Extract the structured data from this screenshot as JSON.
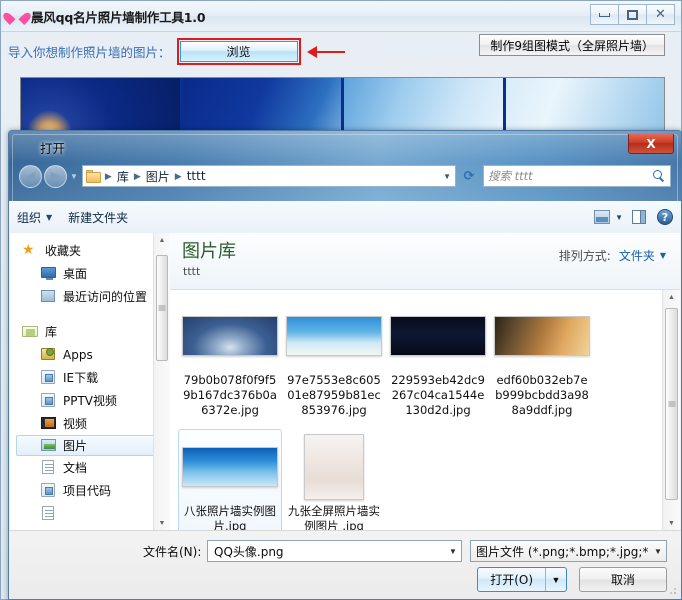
{
  "app": {
    "title": "晨风qq名片照片墙制作工具1.0",
    "icon": "heart-icon",
    "window_buttons": {
      "minimize": "minimize-icon",
      "maximize": "maximize-icon",
      "close": "close-icon"
    },
    "import_label": "导入你想制作照片墙的图片：",
    "browse_button": "浏览",
    "make9_button": "制作9组图模式（全屏照片墙）",
    "highlight_color": "#e01b1b",
    "label_color": "#3a6fb5"
  },
  "dialog": {
    "title": "打开",
    "icon": "heart-icon",
    "close_label": "X",
    "nav": {
      "back": "◀",
      "forward": "▶",
      "history_caret": "▼",
      "breadcrumb": [
        "库",
        "图片",
        "tttt"
      ],
      "breadcrumb_caret": "▼",
      "refresh": "refresh-icon",
      "search_placeholder": "搜索 tttt"
    },
    "commandbar": {
      "organize": "组织",
      "new_folder": "新建文件夹",
      "view_icon": "view-mode-icon",
      "view_caret": "▼",
      "preview_pane_icon": "preview-pane-icon",
      "help_icon": "?"
    },
    "sidebar": {
      "groups": [
        {
          "label": "收藏夹",
          "icon": "star-icon",
          "items": [
            {
              "label": "桌面",
              "icon": "desktop-icon"
            },
            {
              "label": "最近访问的位置",
              "icon": "recent-places-icon"
            }
          ]
        },
        {
          "label": "库",
          "icon": "library-icon",
          "items": [
            {
              "label": "Apps",
              "icon": "apps-icon"
            },
            {
              "label": "IE下载",
              "icon": "folder-blue-icon"
            },
            {
              "label": "PPTV视频",
              "icon": "folder-blue-icon"
            },
            {
              "label": "视频",
              "icon": "film-icon"
            },
            {
              "label": "图片",
              "icon": "pictures-icon",
              "selected": true
            },
            {
              "label": "文档",
              "icon": "document-icon"
            },
            {
              "label": "项目代码",
              "icon": "folder-blue-icon"
            }
          ]
        }
      ]
    },
    "library": {
      "title": "图片库",
      "subtitle": "tttt",
      "arrange_label": "排列方式:",
      "arrange_value": "文件夹",
      "arrange_caret": "▼"
    },
    "files": [
      {
        "name": "79b0b078f0f9f59b167dc376b0a6372e.jpg",
        "thumb": "th1",
        "shape": "t-wide",
        "selected": false
      },
      {
        "name": "97e7553e8c60501e87959b81ec853976.jpg",
        "thumb": "th2",
        "shape": "t-wide",
        "selected": false
      },
      {
        "name": "229593eb42dc9267c04ca1544e130d2d.jpg",
        "thumb": "th3",
        "shape": "t-wide",
        "selected": false
      },
      {
        "name": "edf60b032eb7eb999bcbdd3a988a9ddf.jpg",
        "thumb": "th4",
        "shape": "t-wide",
        "selected": false
      },
      {
        "name": "八张照片墙实例图片.jpg",
        "thumb": "th5",
        "shape": "t-wide",
        "selected": true
      },
      {
        "name": "九张全屏照片墙实例图片 .jpg",
        "thumb": "th6",
        "shape": "t-tall",
        "selected": false
      }
    ],
    "footer": {
      "filename_label": "文件名(N):",
      "filename_value": "QQ头像.png",
      "filename_caret": "▼",
      "filetype_value": "图片文件 (*.png;*.bmp;*.jpg;*",
      "filetype_caret": "▼",
      "open_button": "打开(O)",
      "open_split_caret": "▼",
      "cancel_button": "取消"
    }
  }
}
